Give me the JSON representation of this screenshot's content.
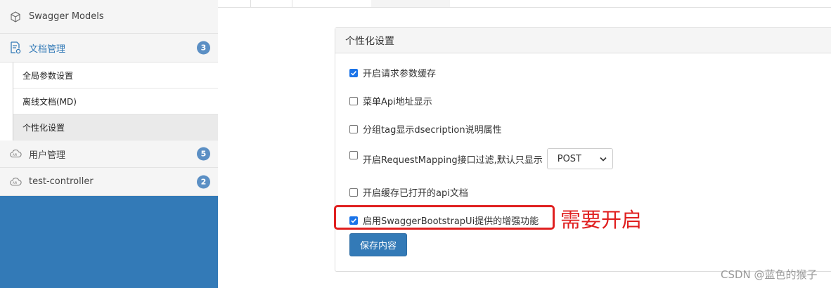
{
  "sidebar": {
    "swagger_models": "Swagger Models",
    "doc_manage": {
      "label": "文档管理",
      "badge": "3"
    },
    "sub_items": [
      {
        "label": "全局参数设置"
      },
      {
        "label": "离线文档(MD)"
      },
      {
        "label": "个性化设置"
      }
    ],
    "user_manage": {
      "label": "用户管理",
      "badge": "5"
    },
    "test_controller": {
      "label": "test-controller",
      "badge": "2"
    }
  },
  "panel": {
    "title": "个性化设置",
    "options": [
      {
        "label": "开启请求参数缓存",
        "checked": true
      },
      {
        "label": "菜单Api地址显示",
        "checked": false
      },
      {
        "label": "分组tag显示dsecription说明属性",
        "checked": false
      },
      {
        "label": "开启RequestMapping接口过滤,默认只显示",
        "checked": false,
        "select_value": "POST"
      },
      {
        "label": "开启缓存已打开的api文档",
        "checked": false
      },
      {
        "label": "启用SwaggerBootstrapUi提供的增强功能",
        "checked": true
      }
    ],
    "save_label": "保存内容"
  },
  "annotation": "需要开启",
  "watermark": "CSDN @蓝色的猴子",
  "colors": {
    "accent": "#337ab7",
    "annotation": "#e02020",
    "checkbox": "#1a73e8"
  }
}
